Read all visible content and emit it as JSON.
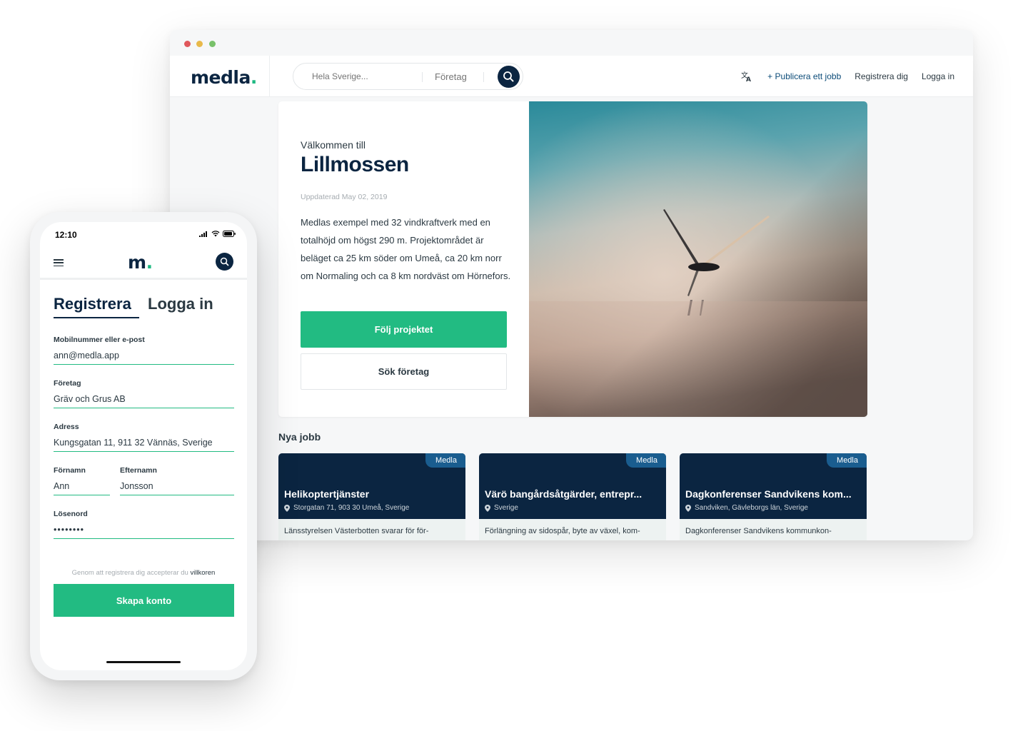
{
  "browser": {
    "logo": "medla",
    "logo_dot": ".",
    "search": {
      "location_placeholder": "Hela Sverige...",
      "company_placeholder": "Företag"
    },
    "nav": {
      "publish": "+ Publicera ett jobb",
      "register": "Registrera dig",
      "login": "Logga in"
    },
    "hero": {
      "welcome": "Välkommen till",
      "project_name": "Lillmossen",
      "updated": "Uppdaterad May 02, 2019",
      "description": "Medlas exempel med 32 vindkraftverk med en totalhöjd om högst 290 m. Projektområdet är beläget ca 25 km söder om Umeå, ca 20 km norr om Normaling och ca 8 km nordväst om Hörnefors.",
      "follow_button": "Följ projektet",
      "search_companies_button": "Sök företag"
    },
    "jobs_title": "Nya jobb",
    "jobs": [
      {
        "badge": "Medla",
        "title": "Helikoptertjänster",
        "location": "Storgatan 71, 903 30 Umeå, Sverige",
        "description": "Länsstyrelsen Västerbotten svarar för för-"
      },
      {
        "badge": "Medla",
        "title": "Värö bangårdsåtgärder, entrepr...",
        "location": "Sverige",
        "description": "Förlängning av sidospår, byte av växel, kom-"
      },
      {
        "badge": "Medla",
        "title": "Dagkonferenser Sandvikens kom...",
        "location": "Sandviken, Gävleborgs län, Sverige",
        "description": "Dagkonferenser Sandvikens kommunkon-"
      }
    ]
  },
  "phone": {
    "time": "12:10",
    "logo": "m",
    "logo_dot": ".",
    "tabs": {
      "register": "Registrera",
      "login": "Logga in"
    },
    "form": {
      "contact_label": "Mobilnummer eller e-post",
      "contact_value": "ann@medla.app",
      "company_label": "Företag",
      "company_value": "Gräv och Grus AB",
      "address_label": "Adress",
      "address_value": "Kungsgatan 11, 911 32 Vännäs, Sverige",
      "firstname_label": "Förnamn",
      "firstname_value": "Ann",
      "lastname_label": "Efternamn",
      "lastname_value": "Jonsson",
      "password_label": "Lösenord",
      "password_value": "••••••••"
    },
    "terms_text": "Genom att registrera dig accepterar du",
    "terms_link": "villkoren",
    "create_button": "Skapa konto"
  },
  "colors": {
    "brand_navy": "#0b2541",
    "brand_green": "#22bb82",
    "badge_blue": "#1a5d8f"
  }
}
